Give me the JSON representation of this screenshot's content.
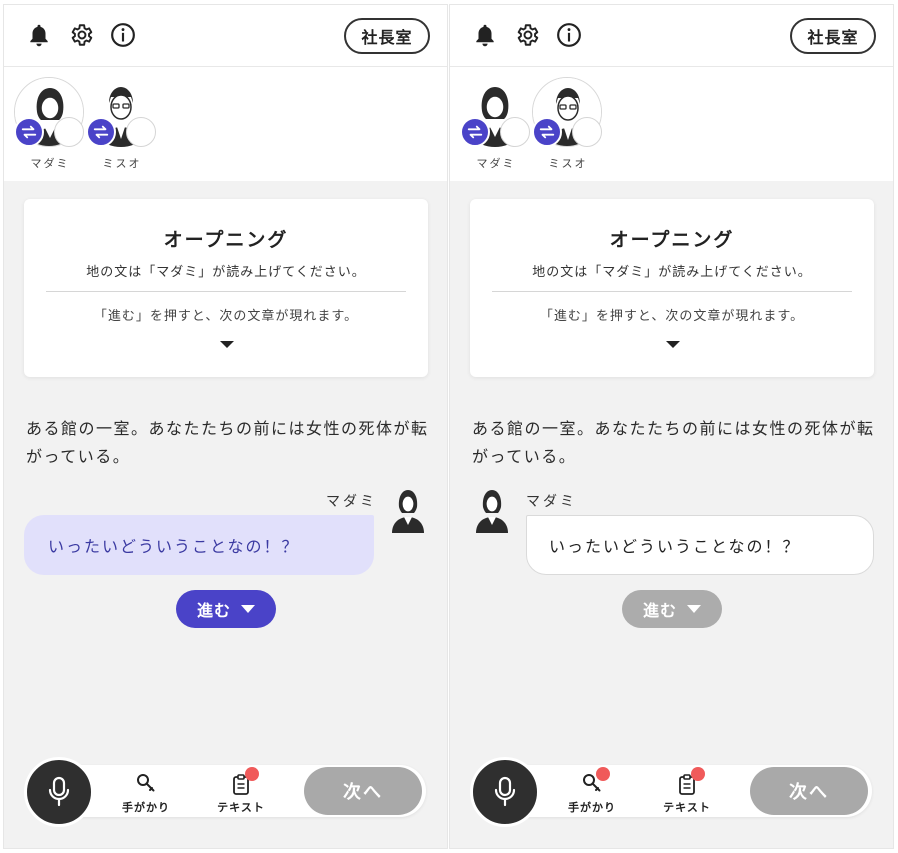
{
  "colors": {
    "accent": "#4a43c8",
    "bubble_self_bg": "#e1e0fb",
    "badge": "#f05a5a",
    "disabled": "#acacac"
  },
  "panels": [
    {
      "header": {
        "icons": [
          "bell-icon",
          "gear-icon",
          "info-icon"
        ],
        "room_button": "社長室"
      },
      "characters": [
        {
          "name": "マダミ",
          "icon": "woman-avatar"
        },
        {
          "name": "ミスオ",
          "icon": "man-glasses-avatar"
        }
      ],
      "scene": {
        "title": "オープニング",
        "subtitle": "地の文は「マダミ」が読み上げてください。",
        "hint": "「進む」を押すと、次の文章が現れます。"
      },
      "narration": "ある館の一室。あなたたちの前には女性の死体が転がっている。",
      "message": {
        "speaker": "マダミ",
        "text": "いったいどういうことなの！？",
        "side": "self"
      },
      "proceed": {
        "label": "進む",
        "enabled": true
      },
      "bottom_bar": {
        "tools": [
          {
            "label": "手がかり",
            "icon": "search-key-icon",
            "badge": false
          },
          {
            "label": "テキスト",
            "icon": "clipboard-icon",
            "badge": true
          }
        ],
        "next": "次へ"
      }
    },
    {
      "header": {
        "icons": [
          "bell-icon",
          "gear-icon",
          "info-icon"
        ],
        "room_button": "社長室"
      },
      "characters": [
        {
          "name": "マダミ",
          "icon": "woman-avatar"
        },
        {
          "name": "ミスオ",
          "icon": "man-glasses-avatar"
        }
      ],
      "scene": {
        "title": "オープニング",
        "subtitle": "地の文は「マダミ」が読み上げてください。",
        "hint": "「進む」を押すと、次の文章が現れます。"
      },
      "narration": "ある館の一室。あなたたちの前には女性の死体が転がっている。",
      "message": {
        "speaker": "マダミ",
        "text": "いったいどういうことなの！？",
        "side": "other"
      },
      "proceed": {
        "label": "進む",
        "enabled": false
      },
      "bottom_bar": {
        "tools": [
          {
            "label": "手がかり",
            "icon": "search-key-icon",
            "badge": true
          },
          {
            "label": "テキスト",
            "icon": "clipboard-icon",
            "badge": true
          }
        ],
        "next": "次へ"
      }
    }
  ]
}
